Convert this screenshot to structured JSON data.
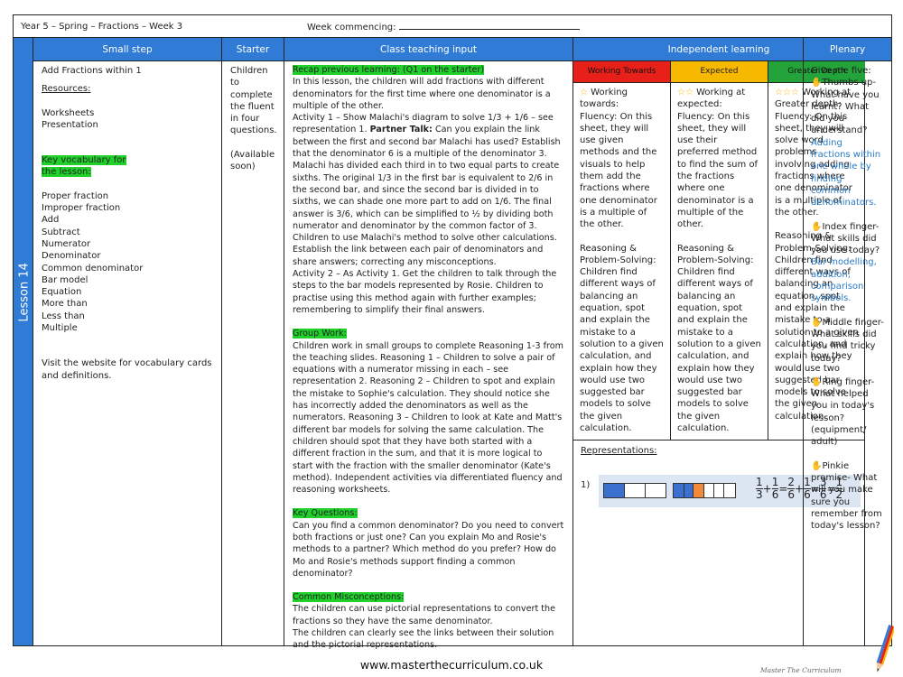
{
  "header": {
    "title": "Year 5 – Spring – Fractions – Week 3",
    "week_label": "Week commencing:"
  },
  "lesson_label": "Lesson 14",
  "columns": {
    "small_step": "Small step",
    "starter": "Starter",
    "teaching": "Class teaching input",
    "independent": "Independent learning",
    "plenary": "Plenary"
  },
  "small_step": {
    "title": "Add Fractions within 1",
    "resources_label": "Resources:",
    "resources": [
      "Worksheets",
      "Presentation"
    ],
    "vocab_label_1": "Key vocabulary for",
    "vocab_label_2": "the lesson:",
    "vocab": [
      "Proper fraction",
      "Improper fraction",
      "Add",
      "Subtract",
      "Numerator",
      "Denominator",
      "Common denominator",
      "Bar model",
      "Equation",
      "More than",
      "Less than",
      "Multiple"
    ],
    "website_note": "Visit the website for vocabulary cards and definitions."
  },
  "starter": {
    "text": "Children to complete the fluent in four questions.",
    "note": "(Available soon)"
  },
  "teaching": {
    "recap_label": "Recap previous learning: (Q1 on the starter)",
    "para1a": "In this lesson, the children will add fractions with different denominators for the first time where one denominator is a multiple of the other.",
    "para1b": "Activity 1 – Show Malachi's diagram to solve 1/3 + 1/6 – see representation 1. ",
    "partner_talk": "Partner Talk:",
    "para1c": " Can you explain the link between the first and second bar Malachi has used? Establish that the denominator 6 is a multiple of the denominator 3. Malachi has divided each third in to two equal parts to create sixths. The original 1/3 in the first bar is equivalent to 2/6 in the second bar, and since the second bar is divided in to sixths, we can shade one more part to add on 1/6. The final answer is 3/6, which can be simplified to ½ by dividing both numerator and denominator by the common factor of 3. Children to use Malachi's method to solve other calculations. Establish the link between each pair of denominators and share answers; correcting any misconceptions.",
    "para1d": "Activity 2 – As Activity 1. Get the children to talk through the steps to the bar models represented by Rosie. Children to practise using this method again with further examples; remembering to simplify their final answers.",
    "group_label": "Group Work:",
    "group_text": "Children work in small groups to complete Reasoning 1-3 from the teaching slides. Reasoning 1 – Children to solve a pair of equations with a numerator missing in each – see representation 2. Reasoning 2 – Children to spot and explain the mistake to Sophie's calculation. They should notice she has incorrectly added the denominators as well as the numerators. Reasoning 3 – Children to look at Kate and Matt's different bar models for solving the same calculation. The children should spot that they have both started with a different fraction in the sum, and that it is more logical to start with the fraction with the smaller denominator (Kate's method).  Independent activities via differentiated fluency and reasoning worksheets.",
    "questions_label": "Key Questions:",
    "questions_text": "Can you find a common denominator? Do you need to convert both fractions or just one? Can you explain Mo and Rosie's methods to a partner? Which method do you prefer? How do Mo and Rosie's methods support finding a common denominator?",
    "misconceptions_label": "Common Misconceptions:",
    "misconceptions_1": "The children can use pictorial representations to convert the fractions so they have the same denominator.",
    "misconceptions_2": "The children can clearly see the links between their solution and the pictorial representations."
  },
  "independent": {
    "levels": [
      {
        "name": "Working Towards",
        "stars": "☆",
        "heading": "Working towards:",
        "fluency": "Fluency: On this sheet, they will use given methods and the visuals to help them add the fractions where one denominator is a multiple of the other.",
        "reasoning": "Reasoning & Problem-Solving: Children find different ways of balancing an equation, spot and explain the mistake to a solution to a given calculation, and explain how they would use two suggested bar models to solve the given calculation.",
        "color": "#e8201a"
      },
      {
        "name": "Expected",
        "stars": "☆☆",
        "heading": "Working at expected:",
        "fluency": "Fluency: On this sheet, they will use their preferred method to find the sum of the fractions where one denominator is a multiple of the other.",
        "reasoning": "Reasoning & Problem-Solving: Children find different ways of balancing an equation, spot and explain the mistake to a solution to a given calculation, and explain how they would use two suggested bar models to solve the given calculation.",
        "color": "#f7b800"
      },
      {
        "name": "Greater Depth",
        "stars": "☆☆☆",
        "heading": "Working at Greater depth:",
        "fluency": "Fluency: On this sheet, they will solve word problems involving adding fractions where one denominator is a multiple of the other.",
        "reasoning": "Reasoning & Problem-Solving: Children find different ways of balancing an equation, spot and explain the mistake to a solution to a given calculation, and explain how they would use two suggested bar models to solve the given calculation.",
        "color": "#22a43a"
      }
    ],
    "representations_label": "Representations:",
    "rep_number": "1)",
    "equation": {
      "fractions": [
        [
          "1",
          "3"
        ],
        [
          "1",
          "6"
        ],
        [
          "2",
          "6"
        ],
        [
          "1",
          "6"
        ],
        [
          "3",
          "6"
        ],
        [
          "1",
          "2"
        ]
      ],
      "ops": [
        "+",
        "=",
        "+",
        "=",
        "="
      ]
    }
  },
  "plenary": {
    "intro": "Give me five:",
    "items": [
      {
        "label": "Thumbs up- What have you learnt? What did you understand?",
        "answer": "Adding fractions within one whole by finding common denominators."
      },
      {
        "label": "Index finger- What skills did you use today?",
        "answer": "Bar modelling, addition, comparison symbols."
      },
      {
        "label": "Middle finger- What skills did you find tricky today?",
        "answer": ""
      },
      {
        "label": "Ring finger- What helped you in today's lesson? (equipment/ adult)",
        "answer": ""
      },
      {
        "label": "Pinkie promise- What will you make sure you remember from today's lesson?",
        "answer": ""
      }
    ]
  },
  "footer": {
    "url": "www.masterthecurriculum.co.uk",
    "brand": "Master The Curriculum"
  }
}
